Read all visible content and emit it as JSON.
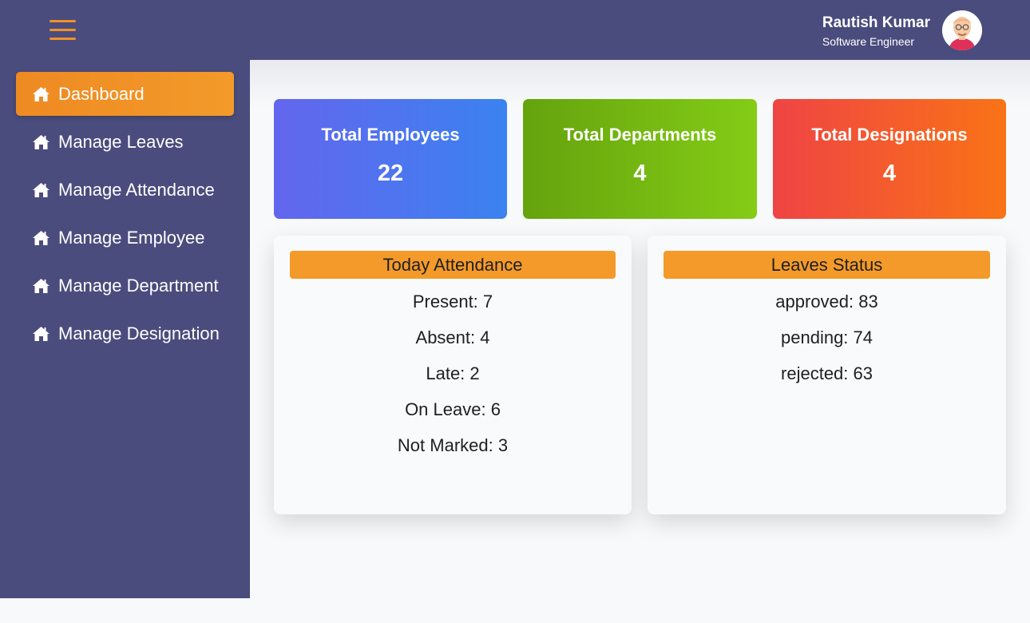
{
  "header": {
    "menu_icon": "hamburger-icon",
    "user_name": "Rautish Kumar",
    "user_role": "Software Engineer",
    "accent_color": "#f0912a",
    "background_color": "#4a4c7d"
  },
  "sidebar": {
    "items": [
      {
        "label": "Dashboard",
        "icon": "home-icon",
        "active": true
      },
      {
        "label": "Manage Leaves",
        "icon": "home-icon",
        "active": false
      },
      {
        "label": "Manage Attendance",
        "icon": "home-icon",
        "active": false
      },
      {
        "label": "Manage Employee",
        "icon": "home-icon",
        "active": false
      },
      {
        "label": "Manage Department",
        "icon": "home-icon",
        "active": false
      },
      {
        "label": "Manage Designation",
        "icon": "home-icon",
        "active": false
      }
    ]
  },
  "stats": [
    {
      "title": "Total Employees",
      "value": "22",
      "color": "#5b6cf0"
    },
    {
      "title": "Total Departments",
      "value": "4",
      "color": "#74b816"
    },
    {
      "title": "Total Designations",
      "value": "4",
      "color": "#f25b33"
    }
  ],
  "attendance": {
    "title": "Today Attendance",
    "lines": [
      "Present: 7",
      "Absent: 4",
      "Late: 2",
      "On Leave: 6",
      "Not Marked: 3"
    ]
  },
  "leaves": {
    "title": "Leaves Status",
    "lines": [
      "approved: 83",
      "pending: 74",
      "rejected: 63"
    ]
  }
}
